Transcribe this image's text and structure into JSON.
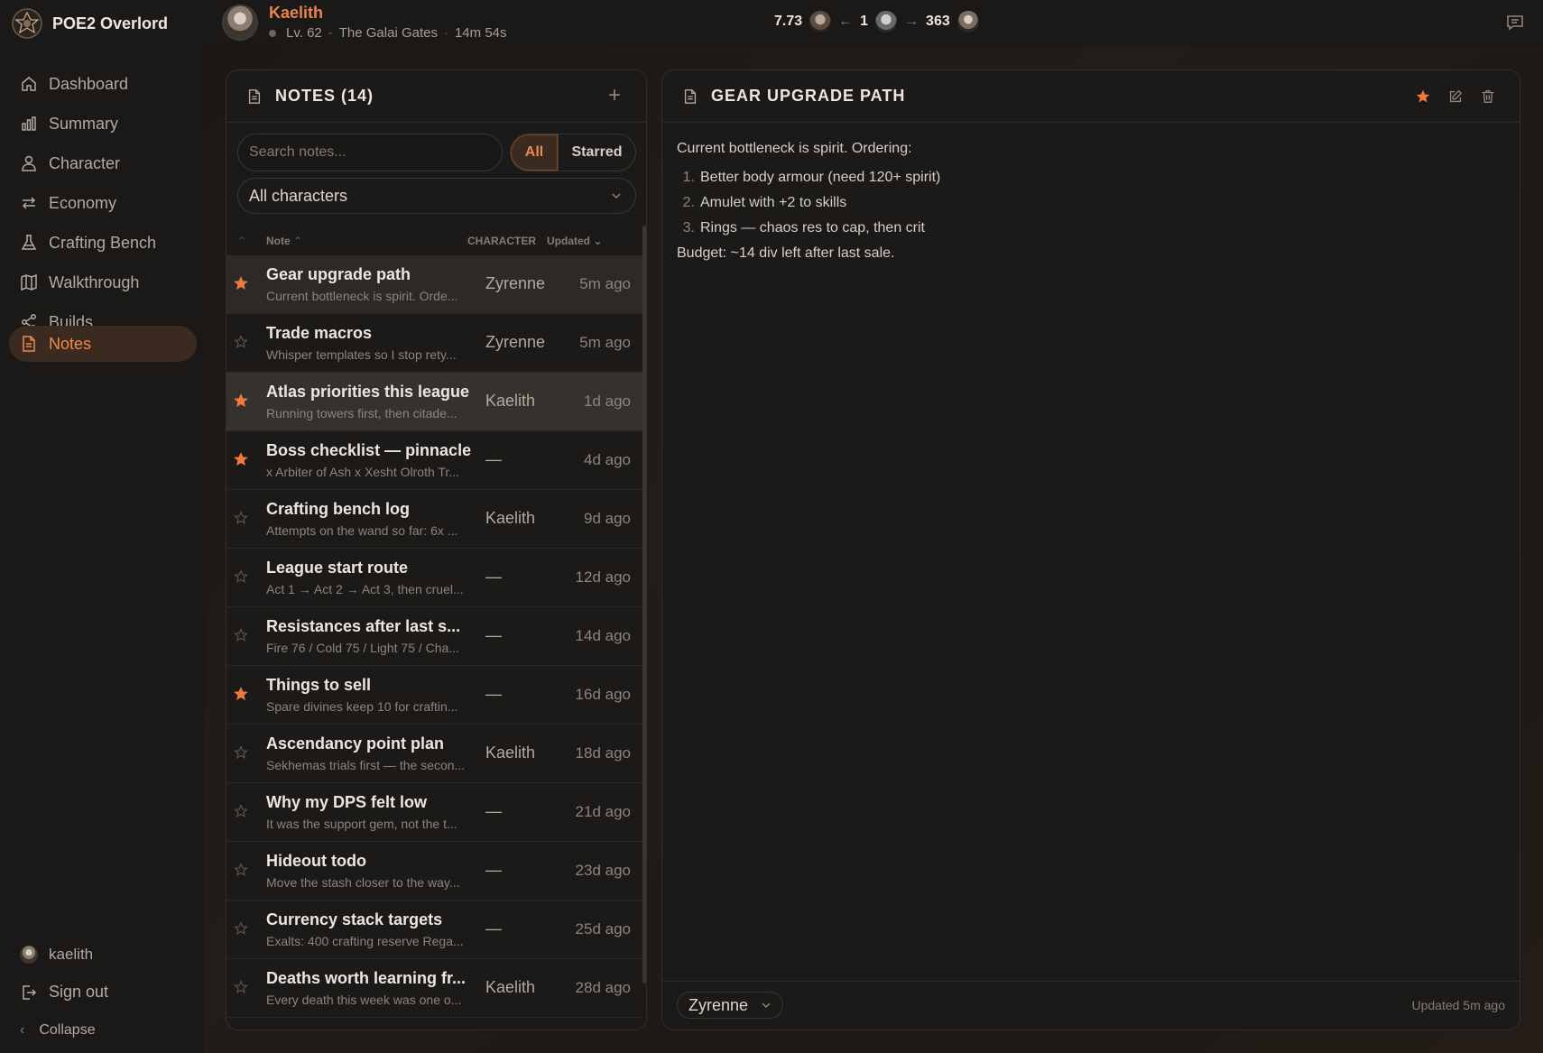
{
  "app": {
    "name": "POE2 Overlord"
  },
  "character": {
    "name": "Kaelith",
    "level": "Lv. 62",
    "zone": "The Galai Gates",
    "session_time": "14m 54s"
  },
  "currency": {
    "rate": "7.73",
    "from_amount": "1",
    "to_amount": "363",
    "arrow": "→"
  },
  "sidebar": {
    "items": [
      {
        "label": "Dashboard",
        "icon": "home-icon",
        "active": false
      },
      {
        "label": "Summary",
        "icon": "bar-chart-icon",
        "active": false
      },
      {
        "label": "Character",
        "icon": "user-icon",
        "active": false
      },
      {
        "label": "Economy",
        "icon": "exchange-icon",
        "active": false
      },
      {
        "label": "Crafting Bench",
        "icon": "flask-icon",
        "active": false
      },
      {
        "label": "Walkthrough",
        "icon": "map-icon",
        "active": false
      },
      {
        "label": "Builds",
        "icon": "share-icon",
        "active": false
      },
      {
        "label": "Notes",
        "icon": "document-icon",
        "active": true
      }
    ],
    "username": "kaelith",
    "sign_out": "Sign out",
    "collapse": "Collapse"
  },
  "notes": {
    "title": "NOTES (14)",
    "add_label": "+",
    "search_placeholder": "Search notes...",
    "filter_all": "All",
    "filter_starred": "Starred",
    "character_filter": "All characters",
    "columns": {
      "note": "Note",
      "character": "CHARACTER",
      "updated": "Updated"
    },
    "rows": [
      {
        "title": "Gear upgrade path",
        "preview": "Current bottleneck is spirit. Orde...",
        "character": "Zyrenne",
        "updated": "5m ago",
        "starred": true
      },
      {
        "title": "Trade macros",
        "preview": "Whisper templates so I stop rety...",
        "character": "Zyrenne",
        "updated": "5m ago",
        "starred": false
      },
      {
        "title": "Atlas priorities this league",
        "preview": "Running towers first, then citade...",
        "character": "Kaelith",
        "updated": "1d ago",
        "starred": true
      },
      {
        "title": "Boss checklist — pinnacle",
        "preview": "x Arbiter of Ash x Xesht Olroth Tr...",
        "character": "—",
        "updated": "4d ago",
        "starred": true
      },
      {
        "title": "Crafting bench log",
        "preview": "Attempts on the wand so far: 6x ...",
        "character": "Kaelith",
        "updated": "9d ago",
        "starred": false
      },
      {
        "title": "League start route",
        "preview": "Act 1 → Act 2 → Act 3, then cruel...",
        "character": "—",
        "updated": "12d ago",
        "starred": false
      },
      {
        "title": "Resistances after last s...",
        "preview": "Fire 76 / Cold 75 / Light 75 / Cha...",
        "character": "—",
        "updated": "14d ago",
        "starred": false
      },
      {
        "title": "Things to sell",
        "preview": "Spare divines keep 10 for craftin...",
        "character": "—",
        "updated": "16d ago",
        "starred": true
      },
      {
        "title": "Ascendancy point plan",
        "preview": "Sekhemas trials first — the secon...",
        "character": "Kaelith",
        "updated": "18d ago",
        "starred": false
      },
      {
        "title": "Why my DPS felt low",
        "preview": "It was the support gem, not the t...",
        "character": "—",
        "updated": "21d ago",
        "starred": false
      },
      {
        "title": "Hideout todo",
        "preview": "Move the stash closer to the way...",
        "character": "—",
        "updated": "23d ago",
        "starred": false
      },
      {
        "title": "Currency stack targets",
        "preview": "Exalts: 400 crafting reserve Rega...",
        "character": "—",
        "updated": "25d ago",
        "starred": false
      },
      {
        "title": "Deaths worth learning fr...",
        "preview": "Every death this week was one o...",
        "character": "Kaelith",
        "updated": "28d ago",
        "starred": false
      }
    ]
  },
  "detail": {
    "title": "GEAR UPGRADE PATH",
    "intro": "Current bottleneck is spirit. Ordering:",
    "list": [
      {
        "num": "1.",
        "text": "Better body armour (need 120+ spirit)"
      },
      {
        "num": "2.",
        "text": "Amulet with +2 to skills"
      },
      {
        "num": "3.",
        "text": "Rings — chaos res to cap, then crit"
      }
    ],
    "budget": "Budget: ~14 div left after last sale.",
    "character": "Zyrenne",
    "updated": "Updated 5m ago"
  },
  "colors": {
    "accent": "#ee8a50",
    "star_filled": "#f07a3c",
    "star_empty": "#5a534c"
  }
}
